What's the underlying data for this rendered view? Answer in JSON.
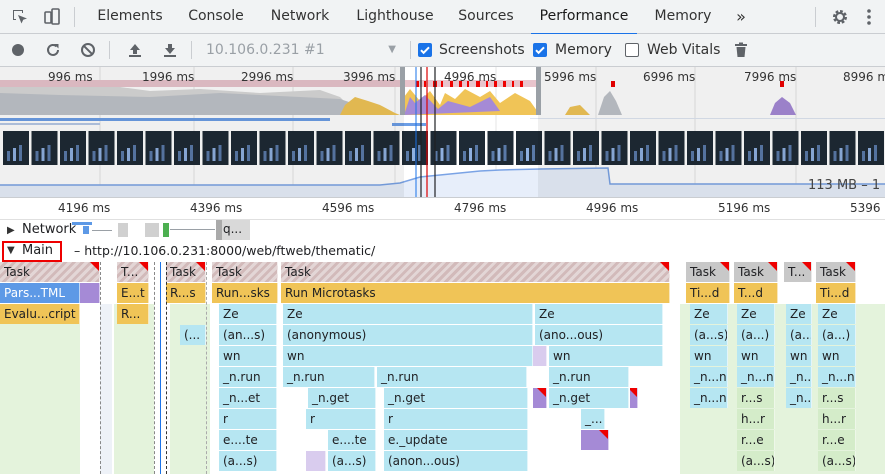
{
  "tabs": {
    "elements": "Elements",
    "console": "Console",
    "network": "Network",
    "lighthouse": "Lighthouse",
    "sources": "Sources",
    "performance": "Performance",
    "memory": "Memory",
    "more": "»"
  },
  "toolbar": {
    "target": "10.106.0.231 #1",
    "screenshots": "Screenshots",
    "memory": "Memory",
    "web_vitals": "Web Vitals",
    "screenshots_checked": true,
    "memory_checked": true,
    "web_vitals_checked": false
  },
  "overview": {
    "ticks": [
      "996 ms",
      "1996 ms",
      "2996 ms",
      "3996 ms",
      "4996 ms",
      "5996 ms",
      "6996 ms",
      "7996 ms",
      "8996 ms"
    ],
    "heap_label": "113 MB – 1"
  },
  "detail": {
    "ticks": [
      "4196 ms",
      "4396 ms",
      "4596 ms",
      "4796 ms",
      "4996 ms",
      "5196 ms",
      "5396"
    ]
  },
  "tracks": {
    "network": "Network",
    "network_item": "q...",
    "main": "Main",
    "main_url": "– http://10.106.0.231:8000/web/ftweb/thematic/"
  },
  "flame": {
    "row0": [
      "Task",
      "T...",
      "Task",
      "Task",
      "Task",
      "Task",
      "Task",
      "T...",
      "Task"
    ],
    "row1": [
      "Pars...TML",
      "E...t",
      "R...s",
      "Run...sks",
      "Run Microtasks",
      "Ti...d",
      "T...d",
      "Ti...d"
    ],
    "row2": [
      "Evalu...cript",
      "R...",
      "Ze",
      "Ze",
      "Ze",
      "Ze",
      "Ze",
      "Ze",
      "Ze"
    ],
    "row3": [
      "(...",
      "(an...s)",
      "(anonymous)",
      "(ano...ous)",
      "(a...s)",
      "(a...)",
      "(a...)",
      "(a...)"
    ],
    "row4": [
      "wn",
      "wn",
      "wn",
      "wn",
      "wn",
      "wn",
      "wn"
    ],
    "row5": [
      "_n.run",
      "_n.run",
      "_n.run",
      "_n.run",
      "_n...n",
      "_n...n",
      "_n...n",
      "_n...n"
    ],
    "row6": [
      "_n...et",
      "_n.get",
      "_n.get",
      "_n.get",
      "_n...n",
      "r...s",
      "_n...n",
      "r...s"
    ],
    "row7": [
      "r",
      "r",
      "r",
      "_...",
      "h...r",
      "h...r"
    ],
    "row8": [
      "e....te",
      "e....te",
      "e._update",
      "r...e",
      "r...e"
    ],
    "row9": [
      "(a...s)",
      "(a...s)",
      "(anon...ous)",
      "(a...s)",
      "(a...s)"
    ]
  },
  "colors": {
    "accent": "#1a73e8",
    "task": "#c8c8c8",
    "scripting": "#f0c457",
    "parse": "#5d99e6",
    "function": "#b6e6f2",
    "long_task": "#ee0000"
  }
}
